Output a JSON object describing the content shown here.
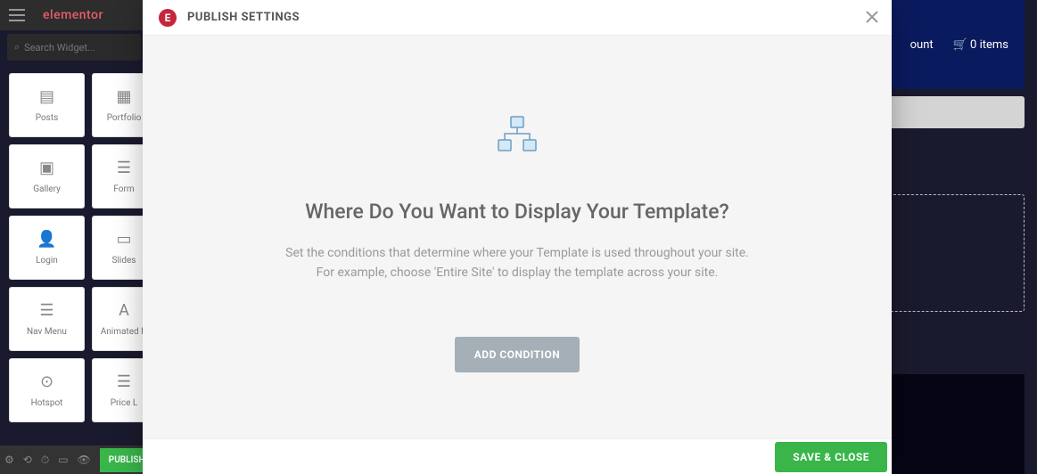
{
  "topbar": {
    "logo": "elementor"
  },
  "search": {
    "placeholder": "Search Widget..."
  },
  "widgets": [
    {
      "label": "Posts"
    },
    {
      "label": "Portfolio"
    },
    {
      "label": "Gallery"
    },
    {
      "label": "Form"
    },
    {
      "label": "Login"
    },
    {
      "label": "Slides"
    },
    {
      "label": "Nav Menu"
    },
    {
      "label": "Animated H"
    },
    {
      "label": "Hotspot"
    },
    {
      "label": "Price L"
    }
  ],
  "right_header": {
    "account_suffix": "ount",
    "cart_label": "0 items"
  },
  "footer": {
    "publish_label": "PUBLISH"
  },
  "modal": {
    "header_icon": "E",
    "title": "PUBLISH SETTINGS",
    "heading": "Where Do You Want to Display Your Template?",
    "desc_line1": "Set the conditions that determine where your Template is used throughout your site.",
    "desc_line2": "For example, choose 'Entire Site' to display the template across your site.",
    "add_condition_label": "ADD CONDITION",
    "save_close_label": "SAVE & CLOSE"
  }
}
